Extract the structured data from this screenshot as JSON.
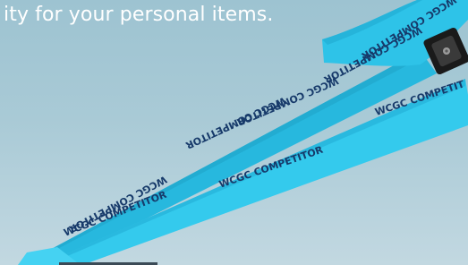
{
  "slide": {
    "caption": "ity for your personal items."
  },
  "lanyard": {
    "strap_color": "#2fc6ea",
    "strap_shadow": "#21a9cd",
    "print_color": "#173a6a",
    "print_text": "WCGC COMPETITOR",
    "print_text_cut_right": "WCGC COMPETIT"
  }
}
